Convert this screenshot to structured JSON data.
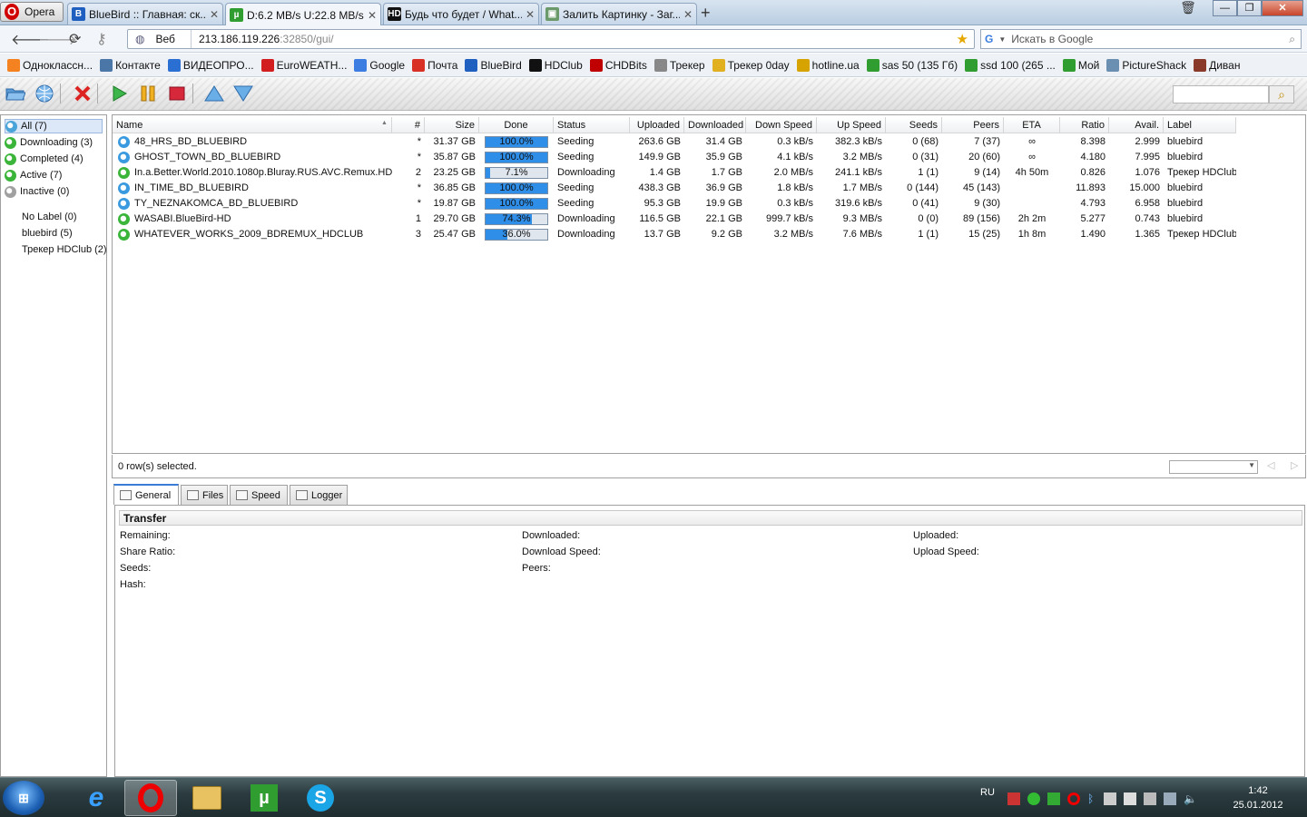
{
  "browser": {
    "opera_label": "Opera",
    "tabs": [
      {
        "title": "BlueBird :: Главная: ск...",
        "icon": "bluebird-icon",
        "active": false
      },
      {
        "title": "D:6.2 MB/s U:22.8 MB/s...",
        "icon": "utorrent-icon",
        "active": true
      },
      {
        "title": "Будь что будет / What...",
        "icon": "hd-icon",
        "active": false
      },
      {
        "title": "Залить Картинку - Заг...",
        "icon": "image-icon",
        "active": false
      }
    ],
    "web_label": "Веб",
    "url_host": "213.186.119.226",
    "url_rest": ":32850/gui/",
    "search_placeholder": "Искать в Google",
    "bookmarks": [
      {
        "label": "Одноклассн...",
        "icon": "odnoklassniki-icon",
        "color": "#f58220"
      },
      {
        "label": "Контакте",
        "icon": "vkontakte-icon",
        "color": "#4a76a8"
      },
      {
        "label": "ВИДЕОПРО...",
        "icon": "video-icon",
        "color": "#2a6fd1"
      },
      {
        "label": "EuroWEATH...",
        "icon": "weather-icon",
        "color": "#d21e1e"
      },
      {
        "label": "Google",
        "icon": "google-icon",
        "color": "#3b7de0"
      },
      {
        "label": "Почта",
        "icon": "gmail-icon",
        "color": "#d93025"
      },
      {
        "label": "BlueBird",
        "icon": "bluebird-icon",
        "color": "#1f5fbf"
      },
      {
        "label": "HDClub",
        "icon": "hd-icon",
        "color": "#111111"
      },
      {
        "label": "CHDBits",
        "icon": "chd-icon",
        "color": "#c00000"
      },
      {
        "label": "Трекер",
        "icon": "tracker-icon",
        "color": "#888888"
      },
      {
        "label": "Трекер 0day",
        "icon": "folder-icon",
        "color": "#e0b020"
      },
      {
        "label": "hotline.ua",
        "icon": "hotline-icon",
        "color": "#d6a300"
      },
      {
        "label": "sas 50 (135 Гб)",
        "icon": "utorrent-icon",
        "color": "#2f9d2f"
      },
      {
        "label": "ssd 100 (265 ...",
        "icon": "utorrent-icon",
        "color": "#2f9d2f"
      },
      {
        "label": "Мой",
        "icon": "utorrent-icon",
        "color": "#2f9d2f"
      },
      {
        "label": "PictureShack",
        "icon": "pictureshack-icon",
        "color": "#6a8fb0"
      },
      {
        "label": "Диван",
        "icon": "divan-icon",
        "color": "#8a3a2a"
      }
    ]
  },
  "sidebar": {
    "categories": [
      {
        "label": "All (7)",
        "color": "#4aa3d9"
      },
      {
        "label": "Downloading (3)",
        "color": "#3ab53a"
      },
      {
        "label": "Completed (4)",
        "color": "#3ab53a"
      },
      {
        "label": "Active (7)",
        "color": "#3ab53a"
      },
      {
        "label": "Inactive (0)",
        "color": "#a0a0a0"
      }
    ],
    "labels": [
      "No Label (0)",
      "bluebird (5)",
      "Трекер HDClub (2)"
    ]
  },
  "columns": [
    "Name",
    "#",
    "Size",
    "Done",
    "Status",
    "Uploaded",
    "Downloaded",
    "Down Speed",
    "Up Speed",
    "Seeds",
    "Peers",
    "ETA",
    "Ratio",
    "Avail.",
    "Label"
  ],
  "torrents": [
    {
      "name": "48_HRS_BD_BLUEBIRD",
      "num": "*",
      "size": "31.37 GB",
      "done": 1.0,
      "done_text": "100.0%",
      "status": "Seeding",
      "uploaded": "263.6 GB",
      "downloaded": "31.4 GB",
      "down_speed": "0.3 kB/s",
      "up_speed": "382.3 kB/s",
      "seeds": "0 (68)",
      "peers": "7 (37)",
      "eta": "∞",
      "ratio": "8.398",
      "avail": "2.999",
      "label": "bluebird",
      "state": "seeding"
    },
    {
      "name": "GHOST_TOWN_BD_BLUEBIRD",
      "num": "*",
      "size": "35.87 GB",
      "done": 1.0,
      "done_text": "100.0%",
      "status": "Seeding",
      "uploaded": "149.9 GB",
      "downloaded": "35.9 GB",
      "down_speed": "4.1 kB/s",
      "up_speed": "3.2 MB/s",
      "seeds": "0 (31)",
      "peers": "20 (60)",
      "eta": "∞",
      "ratio": "4.180",
      "avail": "7.995",
      "label": "bluebird",
      "state": "seeding"
    },
    {
      "name": "In.a.Better.World.2010.1080p.Bluray.RUS.AVC.Remux.HD",
      "num": "2",
      "size": "23.25 GB",
      "done": 0.071,
      "done_text": "7.1%",
      "status": "Downloading",
      "uploaded": "1.4 GB",
      "downloaded": "1.7 GB",
      "down_speed": "2.0 MB/s",
      "up_speed": "241.1 kB/s",
      "seeds": "1 (1)",
      "peers": "9 (14)",
      "eta": "4h 50m",
      "ratio": "0.826",
      "avail": "1.076",
      "label": "Трекер HDClub",
      "state": "downloading"
    },
    {
      "name": "IN_TIME_BD_BLUEBIRD",
      "num": "*",
      "size": "36.85 GB",
      "done": 1.0,
      "done_text": "100.0%",
      "status": "Seeding",
      "uploaded": "438.3 GB",
      "downloaded": "36.9 GB",
      "down_speed": "1.8 kB/s",
      "up_speed": "1.7 MB/s",
      "seeds": "0 (144)",
      "peers": "45 (143)",
      "eta": "",
      "ratio": "11.893",
      "avail": "15.000",
      "label": "bluebird",
      "state": "seeding"
    },
    {
      "name": "TY_NEZNAKOMCA_BD_BLUEBIRD",
      "num": "*",
      "size": "19.87 GB",
      "done": 1.0,
      "done_text": "100.0%",
      "status": "Seeding",
      "uploaded": "95.3 GB",
      "downloaded": "19.9 GB",
      "down_speed": "0.3 kB/s",
      "up_speed": "319.6 kB/s",
      "seeds": "0 (41)",
      "peers": "9 (30)",
      "eta": "",
      "ratio": "4.793",
      "avail": "6.958",
      "label": "bluebird",
      "state": "seeding"
    },
    {
      "name": "WASABI.BlueBird-HD",
      "num": "1",
      "size": "29.70 GB",
      "done": 0.743,
      "done_text": "74.3%",
      "status": "Downloading",
      "uploaded": "116.5 GB",
      "downloaded": "22.1 GB",
      "down_speed": "999.7 kB/s",
      "up_speed": "9.3 MB/s",
      "seeds": "0 (0)",
      "peers": "89 (156)",
      "eta": "2h 2m",
      "ratio": "5.277",
      "avail": "0.743",
      "label": "bluebird",
      "state": "downloading"
    },
    {
      "name": "WHATEVER_WORKS_2009_BDREMUX_HDCLUB",
      "num": "3",
      "size": "25.47 GB",
      "done": 0.36,
      "done_text": "36.0%",
      "status": "Downloading",
      "uploaded": "13.7 GB",
      "downloaded": "9.2 GB",
      "down_speed": "3.2 MB/s",
      "up_speed": "7.6 MB/s",
      "seeds": "1 (1)",
      "peers": "15 (25)",
      "eta": "1h 8m",
      "ratio": "1.490",
      "avail": "1.365",
      "label": "Трекер HDClub",
      "state": "downloading"
    }
  ],
  "status_row": {
    "selected_text": "0 row(s) selected."
  },
  "detail": {
    "tabs": [
      "General",
      "Files",
      "Speed",
      "Logger"
    ],
    "group_title": "Transfer",
    "fields": {
      "remaining": "Remaining:",
      "downloaded": "Downloaded:",
      "uploaded": "Uploaded:",
      "share_ratio": "Share Ratio:",
      "download_speed": "Download Speed:",
      "upload_speed": "Upload Speed:",
      "seeds": "Seeds:",
      "peers": "Peers:",
      "hash": "Hash:"
    }
  },
  "taskbar": {
    "lang": "RU",
    "time": "1:42",
    "date": "25.01.2012"
  }
}
